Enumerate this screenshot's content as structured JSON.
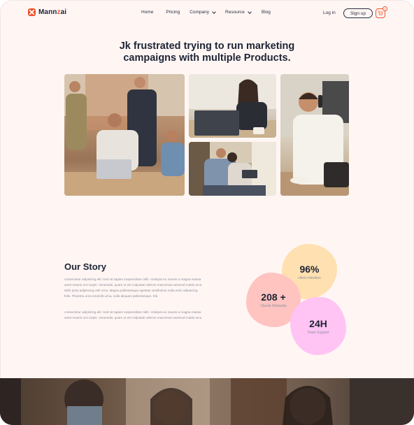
{
  "nav": {
    "logo_prefix": "Mann",
    "logo_accent": "z",
    "logo_suffix": "ai",
    "items": [
      {
        "label": "Home",
        "has_dropdown": false
      },
      {
        "label": "Pricing",
        "has_dropdown": false
      },
      {
        "label": "Company",
        "has_dropdown": true
      },
      {
        "label": "Resource",
        "has_dropdown": true
      },
      {
        "label": "Blog",
        "has_dropdown": false
      }
    ],
    "login_label": "Log in",
    "signup_label": "Sign up",
    "cart_icon": "cart-icon",
    "cart_count": "0"
  },
  "hero": {
    "title_line1": "Jk frustrated trying to run marketing",
    "title_line2": "campaigns with multiple Products."
  },
  "story": {
    "title": "Our Story",
    "paragraph1": "consectetur adipiscing elit. Sed sit sapien suspendisse nibh. Volutpat eu mauris a magna massa amet mauris orci turpis. Venenatis, quam ut est vulputate ultrices maecenas euismod mattis arcu. Nibh justo adipiscing velit urna. Magna pellentesque egestas vestibulum nulla enim adipiscing felis. Pharetra urna tendorib urna, nulla aliquam pellentesque. Elit.",
    "paragraph2": "consectetur adipiscing elit. Sed sit sapien suspendisse nibh. Volutpat eu mauris a magna massa amet mauris orci turpis. Venenatis, quam ut est vulputate ultrices maecenas euismod mattis arcu."
  },
  "stats": [
    {
      "value": "96%",
      "label": "client retention",
      "color": "#ffe0b0"
    },
    {
      "value": "208 +",
      "label": "Clients Wolrwide",
      "color": "#ffc4c0"
    },
    {
      "value": "24H",
      "label": "Team Support",
      "color": "#ffc4f4"
    }
  ],
  "colors": {
    "brand": "#f0532b",
    "heading": "#1d2435",
    "background": "#fff6f4"
  }
}
